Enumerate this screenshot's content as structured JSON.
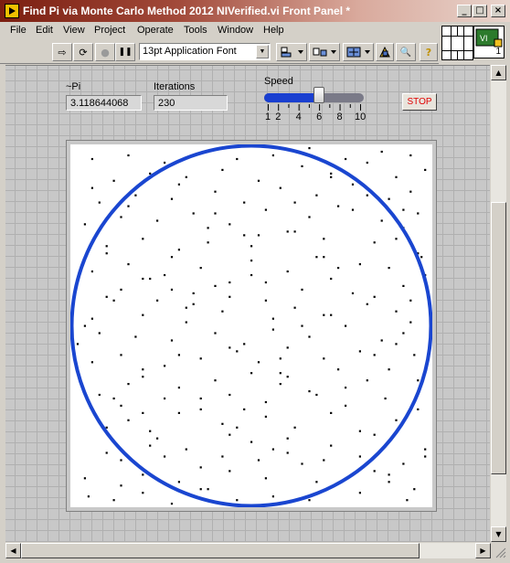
{
  "window": {
    "title": "Find Pi via Monte Carlo Method 2012 NIVerified.vi Front Panel *",
    "minimize_glyph": "_",
    "maximize_glyph": "□",
    "close_glyph": "×"
  },
  "menu": [
    "File",
    "Edit",
    "View",
    "Project",
    "Operate",
    "Tools",
    "Window",
    "Help"
  ],
  "toolbar": {
    "font": "13pt Application Font",
    "run_glyph": "⇨",
    "run_continuous_glyph": "⟳",
    "abort_glyph": "●",
    "pause_glyph": "❚❚",
    "help_glyph": "?",
    "search_glyph": "🔍"
  },
  "controls": {
    "pi_label": "~Pi",
    "pi_value": "3.118644068",
    "iterations_label": "Iterations",
    "iterations_value": "230",
    "speed_label": "Speed",
    "speed_value": 6,
    "speed_scale": [
      "1",
      "2",
      "4",
      "6",
      "8",
      "10"
    ],
    "stop_label": "STOP"
  },
  "vi_icon_text": "1",
  "colors": {
    "circle": "#1a46d0",
    "points": "#000000",
    "slider_fill": "#1a3fd0"
  },
  "chart_data": {
    "type": "scatter",
    "title": "",
    "xlim": [
      0,
      1
    ],
    "ylim": [
      0,
      1
    ],
    "circle": {
      "center": [
        0.5,
        0.5
      ],
      "radius": 0.5
    },
    "x": [
      0.05,
      0.12,
      0.2,
      0.28,
      0.38,
      0.46,
      0.56,
      0.58,
      0.66,
      0.8,
      0.93,
      0.95,
      0.04,
      0.2,
      0.3,
      0.36,
      0.44,
      0.54,
      0.64,
      0.84,
      0.88,
      0.1,
      0.22,
      0.32,
      0.42,
      0.5,
      0.6,
      0.72,
      0.84,
      0.98,
      0.1,
      0.16,
      0.22,
      0.42,
      0.54,
      0.62,
      0.72,
      0.9,
      0.96,
      0.14,
      0.26,
      0.36,
      0.44,
      0.54,
      0.66,
      0.76,
      0.87,
      0.16,
      0.2,
      0.3,
      0.4,
      0.5,
      0.58,
      0.6,
      0.74,
      0.82,
      0.06,
      0.14,
      0.26,
      0.36,
      0.46,
      0.52,
      0.6,
      0.7,
      0.8,
      0.9,
      0.95,
      0.18,
      0.28,
      0.4,
      0.48,
      0.56,
      0.66,
      0.76,
      0.86,
      0.92,
      0.06,
      0.2,
      0.32,
      0.42,
      0.56,
      0.62,
      0.72,
      0.82,
      0.9,
      0.1,
      0.14,
      0.24,
      0.34,
      0.4,
      0.44,
      0.54,
      0.64,
      0.72,
      0.78,
      0.92,
      0.98,
      0.06,
      0.16,
      0.26,
      0.36,
      0.5,
      0.6,
      0.68,
      0.8,
      0.88,
      0.96,
      0.1,
      0.2,
      0.3,
      0.38,
      0.48,
      0.5,
      0.62,
      0.7,
      0.84,
      0.92,
      0.04,
      0.14,
      0.24,
      0.34,
      0.44,
      0.54,
      0.66,
      0.74,
      0.86,
      0.96,
      0.08,
      0.18,
      0.28,
      0.4,
      0.48,
      0.58,
      0.68,
      0.78,
      0.88,
      0.94,
      0.12,
      0.22,
      0.32,
      0.42,
      0.52,
      0.64,
      0.72,
      0.82,
      0.9,
      0.98,
      0.06,
      0.16,
      0.26,
      0.38,
      0.46,
      0.56,
      0.66,
      0.76,
      0.86,
      0.94,
      0.14,
      0.24,
      0.3,
      0.44,
      0.52,
      0.6,
      0.7,
      0.8,
      0.92,
      0.08,
      0.2,
      0.3,
      0.36,
      0.48,
      0.58,
      0.68,
      0.76,
      0.88,
      0.96,
      0.04,
      0.12,
      0.22,
      0.34,
      0.44,
      0.54,
      0.64,
      0.74,
      0.84,
      0.94,
      0.1,
      0.2,
      0.28,
      0.38,
      0.5,
      0.6,
      0.7,
      0.78,
      0.9,
      0.97,
      0.06,
      0.16,
      0.3,
      0.4,
      0.52,
      0.62,
      0.72,
      0.82,
      0.92,
      0.14,
      0.26,
      0.36,
      0.46,
      0.56,
      0.68,
      0.8,
      0.88,
      0.98,
      0.08,
      0.2,
      0.32,
      0.44,
      0.58,
      0.7,
      0.84,
      0.94,
      0.02,
      0.12,
      0.28
    ],
    "y": [
      0.03,
      0.02,
      0.04,
      0.01,
      0.05,
      0.02,
      0.03,
      0.01,
      0.02,
      0.04,
      0.02,
      0.05,
      0.08,
      0.09,
      0.07,
      0.11,
      0.1,
      0.08,
      0.12,
      0.1,
      0.07,
      0.15,
      0.17,
      0.16,
      0.14,
      0.18,
      0.15,
      0.17,
      0.2,
      0.16,
      0.22,
      0.24,
      0.21,
      0.23,
      0.25,
      0.22,
      0.26,
      0.24,
      0.27,
      0.28,
      0.3,
      0.27,
      0.31,
      0.29,
      0.32,
      0.28,
      0.3,
      0.34,
      0.36,
      0.33,
      0.35,
      0.37,
      0.34,
      0.36,
      0.38,
      0.35,
      0.4,
      0.42,
      0.39,
      0.41,
      0.43,
      0.4,
      0.44,
      0.41,
      0.43,
      0.45,
      0.42,
      0.47,
      0.46,
      0.48,
      0.45,
      0.49,
      0.47,
      0.5,
      0.46,
      0.48,
      0.52,
      0.53,
      0.51,
      0.54,
      0.52,
      0.55,
      0.53,
      0.56,
      0.54,
      0.58,
      0.6,
      0.57,
      0.59,
      0.61,
      0.58,
      0.62,
      0.6,
      0.63,
      0.59,
      0.61,
      0.64,
      0.65,
      0.67,
      0.64,
      0.66,
      0.68,
      0.65,
      0.69,
      0.67,
      0.66,
      0.7,
      0.72,
      0.74,
      0.71,
      0.73,
      0.75,
      0.72,
      0.76,
      0.74,
      0.73,
      0.77,
      0.78,
      0.8,
      0.79,
      0.81,
      0.78,
      0.82,
      0.8,
      0.83,
      0.79,
      0.81,
      0.84,
      0.86,
      0.85,
      0.87,
      0.84,
      0.88,
      0.86,
      0.89,
      0.85,
      0.87,
      0.9,
      0.92,
      0.91,
      0.93,
      0.9,
      0.94,
      0.92,
      0.95,
      0.91,
      0.93,
      0.96,
      0.97,
      0.95,
      0.98,
      0.96,
      0.97,
      0.99,
      0.96,
      0.98,
      0.97,
      0.13,
      0.19,
      0.26,
      0.2,
      0.13,
      0.19,
      0.13,
      0.14,
      0.12,
      0.31,
      0.26,
      0.42,
      0.3,
      0.27,
      0.41,
      0.31,
      0.33,
      0.38,
      0.35,
      0.5,
      0.57,
      0.63,
      0.56,
      0.62,
      0.57,
      0.5,
      0.66,
      0.58,
      0.57,
      0.7,
      0.63,
      0.69,
      0.77,
      0.64,
      0.76,
      0.69,
      0.82,
      0.74,
      0.69,
      0.88,
      0.83,
      0.89,
      0.81,
      0.75,
      0.84,
      0.91,
      0.86,
      0.82,
      0.06,
      0.14,
      0.05,
      0.22,
      0.16,
      0.07,
      0.21,
      0.09,
      0.14,
      0.48,
      0.38,
      0.55,
      0.44,
      0.37,
      0.53,
      0.42,
      0.51,
      0.45,
      0.3,
      0.6
    ]
  }
}
